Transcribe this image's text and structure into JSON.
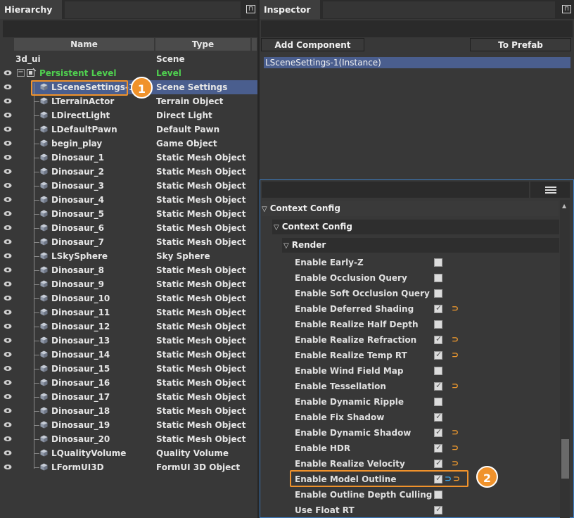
{
  "hierarchy": {
    "tab_title": "Hierarchy",
    "columns": {
      "name": "Name",
      "type": "Type"
    },
    "root": {
      "name": "3d_ui",
      "type": "Scene"
    },
    "level": {
      "name": "Persistent Level",
      "type": "Level"
    },
    "items": [
      {
        "name": "LSceneSettings-1",
        "type": "Scene Settings",
        "selected": true
      },
      {
        "name": "LTerrainActor",
        "type": "Terrain Object"
      },
      {
        "name": "LDirectLight",
        "type": "Direct Light"
      },
      {
        "name": "LDefaultPawn",
        "type": "Default Pawn"
      },
      {
        "name": "begin_play",
        "type": "Game Object"
      },
      {
        "name": "Dinosaur_1",
        "type": "Static Mesh Object"
      },
      {
        "name": "Dinosaur_2",
        "type": "Static Mesh Object"
      },
      {
        "name": "Dinosaur_3",
        "type": "Static Mesh Object"
      },
      {
        "name": "Dinosaur_4",
        "type": "Static Mesh Object"
      },
      {
        "name": "Dinosaur_5",
        "type": "Static Mesh Object"
      },
      {
        "name": "Dinosaur_6",
        "type": "Static Mesh Object"
      },
      {
        "name": "Dinosaur_7",
        "type": "Static Mesh Object"
      },
      {
        "name": "LSkySphere",
        "type": "Sky Sphere"
      },
      {
        "name": "Dinosaur_8",
        "type": "Static Mesh Object"
      },
      {
        "name": "Dinosaur_9",
        "type": "Static Mesh Object"
      },
      {
        "name": "Dinosaur_10",
        "type": "Static Mesh Object"
      },
      {
        "name": "Dinosaur_11",
        "type": "Static Mesh Object"
      },
      {
        "name": "Dinosaur_12",
        "type": "Static Mesh Object"
      },
      {
        "name": "Dinosaur_13",
        "type": "Static Mesh Object"
      },
      {
        "name": "Dinosaur_14",
        "type": "Static Mesh Object"
      },
      {
        "name": "Dinosaur_15",
        "type": "Static Mesh Object"
      },
      {
        "name": "Dinosaur_16",
        "type": "Static Mesh Object"
      },
      {
        "name": "Dinosaur_17",
        "type": "Static Mesh Object"
      },
      {
        "name": "Dinosaur_18",
        "type": "Static Mesh Object"
      },
      {
        "name": "Dinosaur_19",
        "type": "Static Mesh Object"
      },
      {
        "name": "Dinosaur_20",
        "type": "Static Mesh Object"
      },
      {
        "name": "LQualityVolume",
        "type": "Quality Volume"
      },
      {
        "name": "LFormUI3D",
        "type": "FormUI 3D Object"
      }
    ]
  },
  "inspector": {
    "tab_title": "Inspector",
    "add_component": "Add Component",
    "to_prefab": "To Prefab",
    "instance_label": "LSceneSettings-1(Instance)",
    "section1": "Context Config",
    "section2": "Context Config",
    "section3": "Render",
    "properties": [
      {
        "label": "Enable Early-Z",
        "checked": false,
        "reset": ""
      },
      {
        "label": "Enable Occlusion Query",
        "checked": false,
        "reset": ""
      },
      {
        "label": "Enable Soft Occlusion Query",
        "checked": false,
        "reset": ""
      },
      {
        "label": "Enable Deferred Shading",
        "checked": true,
        "reset": "⊃"
      },
      {
        "label": "Enable Realize Half Depth",
        "checked": false,
        "reset": ""
      },
      {
        "label": "Enable Realize Refraction",
        "checked": true,
        "reset": "⊃"
      },
      {
        "label": "Enable Realize Temp RT",
        "checked": true,
        "reset": "⊃"
      },
      {
        "label": "Enable Wind Field Map",
        "checked": false,
        "reset": ""
      },
      {
        "label": "Enable Tessellation",
        "checked": true,
        "reset": "⊃"
      },
      {
        "label": "Enable Dynamic Ripple",
        "checked": false,
        "reset": ""
      },
      {
        "label": "Enable Fix Shadow",
        "checked": true,
        "reset": ""
      },
      {
        "label": "Enable Dynamic Shadow",
        "checked": true,
        "reset": "⊃"
      },
      {
        "label": "Enable HDR",
        "checked": true,
        "reset": "⊃"
      },
      {
        "label": "Enable Realize Velocity",
        "checked": true,
        "reset": "⊃"
      },
      {
        "label": "Enable Model Outline",
        "checked": true,
        "reset": "⊃",
        "reset_blue": "⊃"
      },
      {
        "label": "Enable Outline Depth Culling",
        "checked": false,
        "reset": ""
      },
      {
        "label": "Use Float RT",
        "checked": true,
        "reset": ""
      }
    ]
  },
  "callouts": {
    "one": "1",
    "two": "2"
  },
  "colors": {
    "accent": "#f0922b",
    "selection": "#4a5e8e",
    "level_green": "#4fd04f",
    "focus_border": "#3d7fc6"
  }
}
